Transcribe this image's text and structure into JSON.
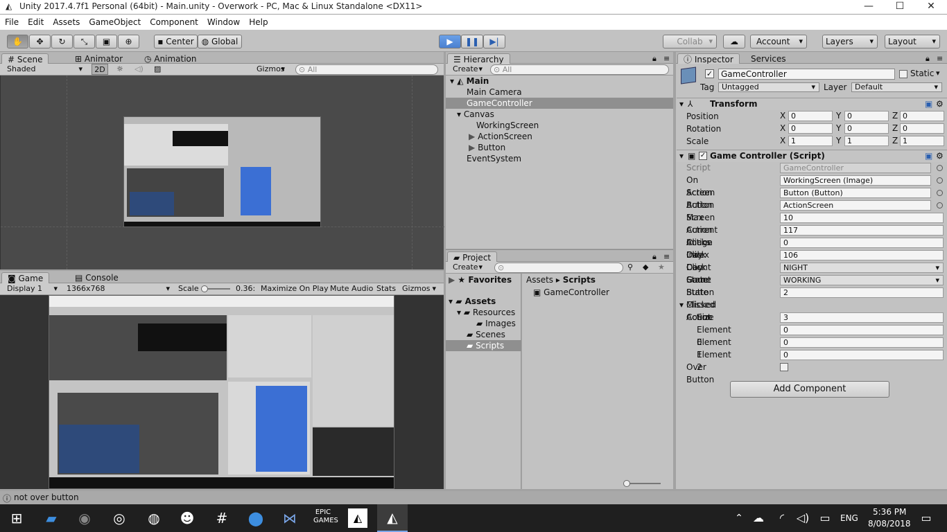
{
  "titlebar": {
    "title": "Unity 2017.4.7f1 Personal (64bit) - Main.unity - Overwork - PC, Mac & Linux Standalone <DX11>",
    "minimize": "—",
    "maximize": "☐",
    "close": "✕"
  },
  "menu": [
    "File",
    "Edit",
    "Assets",
    "GameObject",
    "Component",
    "Window",
    "Help"
  ],
  "toolbar": {
    "center": "Center",
    "global": "Global",
    "collab": "Collab",
    "account": "Account",
    "layers": "Layers",
    "layout": "Layout"
  },
  "scene": {
    "tabs": [
      "Scene",
      "Animator",
      "Animation"
    ],
    "shaded": "Shaded",
    "mode2d": "2D",
    "gizmos": "Gizmos",
    "search": "All"
  },
  "game": {
    "tabs": [
      "Game",
      "Console"
    ],
    "display": "Display 1",
    "resolution": "1366x768",
    "scale_label": "Scale",
    "scale_value": "0.36:",
    "maximize": "Maximize On Play",
    "mute": "Mute Audio",
    "stats": "Stats",
    "gizmos": "Gizmos"
  },
  "hierarchy": {
    "tab": "Hierarchy",
    "create": "Create",
    "search": "All",
    "scene": "Main",
    "items": [
      "Main Camera",
      "GameController",
      "Canvas",
      "WorkingScreen",
      "ActionScreen",
      "Button",
      "EventSystem"
    ]
  },
  "project": {
    "tab": "Project",
    "create": "Create",
    "favorites": "Favorites",
    "assets": "Assets",
    "resources": "Resources",
    "images": "Images",
    "scenes": "Scenes",
    "scripts": "Scripts",
    "breadcrumb_root": "Assets",
    "breadcrumb_sep": "▸",
    "breadcrumb_leaf": "Scripts",
    "file": "GameController"
  },
  "inspector": {
    "tabs": [
      "Inspector",
      "Services"
    ],
    "object_name": "GameController",
    "static": "Static",
    "tag_label": "Tag",
    "tag": "Untagged",
    "layer_label": "Layer",
    "layer": "Default",
    "transform": {
      "title": "Transform",
      "rows": [
        {
          "label": "Position",
          "x": "0",
          "y": "0",
          "z": "0"
        },
        {
          "label": "Rotation",
          "x": "0",
          "y": "0",
          "z": "0"
        },
        {
          "label": "Scale",
          "x": "1",
          "y": "1",
          "z": "1"
        }
      ]
    },
    "script_comp": {
      "title": "Game Controller (Script)",
      "fields": [
        {
          "label": "Script",
          "value": "GameController"
        },
        {
          "label": "On Screen",
          "value": "WorkingScreen (Image)"
        },
        {
          "label": "Action Button",
          "value": "Button (Button)"
        },
        {
          "label": "Action Screen",
          "value": "ActionScreen"
        },
        {
          "label": "Max Action Clicks",
          "value": "10"
        },
        {
          "label": "Current Image Index",
          "value": "117"
        },
        {
          "label": "Action Click Count",
          "value": "0"
        },
        {
          "label": "Day Click Count",
          "value": "106"
        },
        {
          "label": "Day State",
          "value": "NIGHT"
        },
        {
          "label": "Game State",
          "value": "WORKING"
        },
        {
          "label": "Button Clicked Count",
          "value": "2"
        },
        {
          "label": "Missed Action",
          "value": ""
        },
        {
          "label": "Size",
          "value": "3"
        },
        {
          "label": "Element 0",
          "value": "0"
        },
        {
          "label": "Element 1",
          "value": "0"
        },
        {
          "label": "Element 2",
          "value": "0"
        },
        {
          "label": "Over Button",
          "value": ""
        }
      ]
    },
    "add_component": "Add Component"
  },
  "status": {
    "text": "not over button"
  },
  "taskbar": {
    "lang": "ENG",
    "time": "5:36 PM",
    "date": "8/08/2018"
  }
}
